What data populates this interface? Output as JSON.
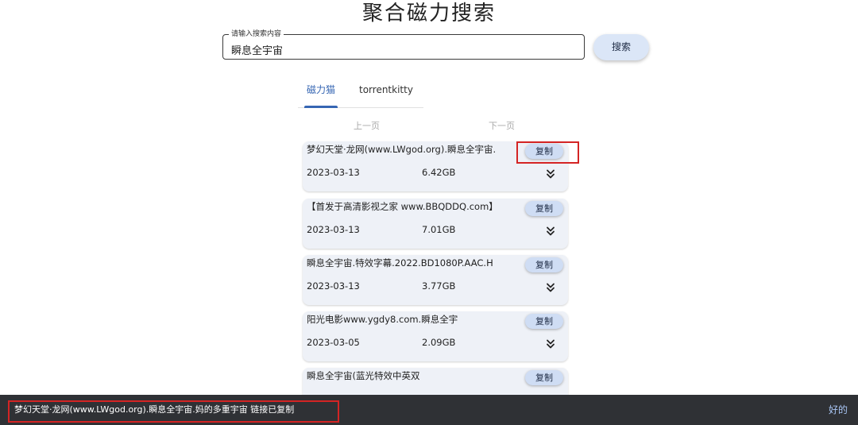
{
  "page": {
    "title": "聚合磁力搜索"
  },
  "search": {
    "legend": "请输入搜索内容",
    "value": "瞬息全宇宙",
    "button_label": "搜索"
  },
  "tabs": [
    {
      "label": "磁力猫",
      "active": true
    },
    {
      "label": "torrentkitty",
      "active": false
    }
  ],
  "pager": {
    "prev_label": "上一页",
    "next_label": "下一页"
  },
  "results": [
    {
      "name": "梦幻天堂·龙网(www.LWgod.org).瞬息全宇宙.",
      "date": "2023-03-13",
      "size": "6.42GB",
      "copy_label": "复制",
      "expand_icon": "double-chevron-down-icon"
    },
    {
      "name": "【首发于高清影视之家 www.BBQDDQ.com】",
      "date": "2023-03-13",
      "size": "7.01GB",
      "copy_label": "复制",
      "expand_icon": "double-chevron-down-icon"
    },
    {
      "name": "瞬息全宇宙.特效字幕.2022.BD1080P.AAC.H",
      "date": "2023-03-13",
      "size": "3.77GB",
      "copy_label": "复制",
      "expand_icon": "double-chevron-down-icon"
    },
    {
      "name": "阳光电影www.ygdy8.com.瞬息全宇",
      "date": "2023-03-05",
      "size": "2.09GB",
      "copy_label": "复制",
      "expand_icon": "double-chevron-down-icon"
    },
    {
      "name": "瞬息全宇宙(蓝光特效中英双",
      "date": "",
      "size": "",
      "copy_label": "复制",
      "expand_icon": ""
    }
  ],
  "snackbar": {
    "message": "梦幻天堂·龙网(www.LWgod.org).瞬息全宇宙.妈的多重宇宙 链接已复制",
    "action_label": "好的"
  },
  "colors": {
    "accent": "#3666b3",
    "card_bg": "#eef1f7",
    "button_bg": "#cfddf4",
    "highlight": "#d42424",
    "snackbar_bg": "#2f3135",
    "snackbar_action": "#a9c6f5"
  }
}
